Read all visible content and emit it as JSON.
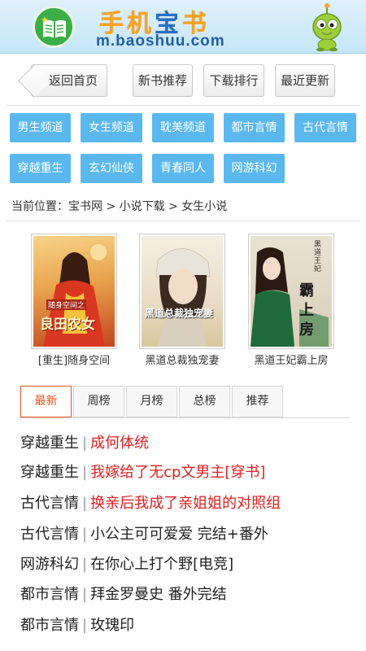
{
  "header": {
    "title_part1": "手机",
    "title_part2": "宝",
    "title_part3": "书",
    "url": "m.baoshuu.com"
  },
  "nav": {
    "back_label": "返回首页",
    "buttons": [
      "新书推荐",
      "下载排行",
      "最近更新"
    ]
  },
  "categories": [
    "男生频道",
    "女生频道",
    "耽美频道",
    "都市言情",
    "古代言情",
    "穿越重生",
    "玄幻仙侠",
    "青春同人",
    "网游科幻"
  ],
  "breadcrumb": "当前位置：宝书网 > 小说下载 > 女生小说",
  "books": [
    {
      "title": "[重生]随身空间",
      "cover_text": "良田农女",
      "cover_sub": "随身空间之"
    },
    {
      "title": "黑道总裁独宠妻",
      "cover_text": "黑道总裁独宠妻",
      "cover_sub": ""
    },
    {
      "title": "黑道王妃霸上房",
      "cover_text": "霸上房",
      "cover_sub": "黑道王妃"
    }
  ],
  "tabs": [
    "最新",
    "周榜",
    "月榜",
    "总榜",
    "推荐"
  ],
  "list": [
    {
      "category": "穿越重生",
      "title": "成何体统",
      "highlight": true
    },
    {
      "category": "穿越重生",
      "title": "我嫁给了无cp文男主[穿书]",
      "highlight": true
    },
    {
      "category": "古代言情",
      "title": "换亲后我成了亲姐姐的对照组",
      "highlight": true
    },
    {
      "category": "古代言情",
      "title": "小公主可可爱爱 完结+番外",
      "highlight": false
    },
    {
      "category": "网游科幻",
      "title": "在你心上打个野[电竞]",
      "highlight": false
    },
    {
      "category": "都市言情",
      "title": "拜金罗曼史 番外完结",
      "highlight": false
    },
    {
      "category": "都市言情",
      "title": "玫瑰印",
      "highlight": false
    }
  ],
  "colors": {
    "accent": "#5ab8ee",
    "active_tab": "#e0571a",
    "highlight_text": "#e02020"
  }
}
